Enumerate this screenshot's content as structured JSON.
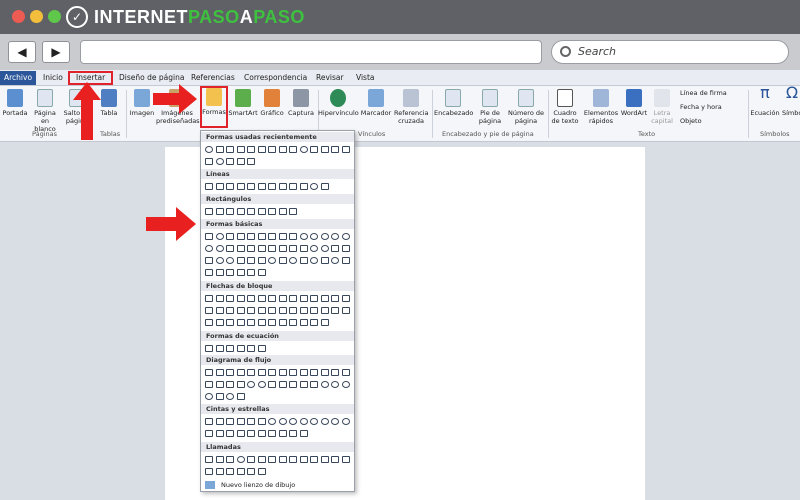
{
  "site_logo": {
    "mark": "✓",
    "text_a": "INTERNET",
    "text_b": "PASO",
    "text_c": "A",
    "text_d": "PASO"
  },
  "browser": {
    "back_label": "◀",
    "forward_label": "▶",
    "search_placeholder": "Search"
  },
  "menu_tabs": [
    "Archivo",
    "Inicio",
    "Insertar",
    "Diseño de página",
    "Referencias",
    "Correspondencia",
    "Revisar",
    "Vista"
  ],
  "ribbon": {
    "buttons": [
      "Portada",
      "Página en blanco",
      "Salto de página",
      "Tabla",
      "Imagen",
      "Imágenes prediseñadas",
      "Formas",
      "SmartArt",
      "Gráfico",
      "Captura",
      "Hipervínculo",
      "Marcador",
      "Referencia cruzada",
      "Encabezado",
      "Pie de página",
      "Número de página",
      "Cuadro de texto",
      "Elementos rápidos",
      "WordArt",
      "Letra capital",
      "Línea de firma",
      "Fecha y hora",
      "Objeto",
      "Ecuación",
      "Símbolo"
    ],
    "groups": [
      "Páginas",
      "Tablas",
      "Vínculos",
      "Encabezado y pie de página",
      "Texto",
      "Símbolos"
    ]
  },
  "shapes_menu": {
    "sections": [
      "Formas usadas recientemente",
      "Líneas",
      "Rectángulos",
      "Formas básicas",
      "Flechas de bloque",
      "Formas de ecuación",
      "Diagrama de flujo",
      "Cintas y estrellas",
      "Llamadas"
    ],
    "new_canvas": "Nuevo lienzo de dibujo"
  },
  "colors": {
    "accent": "#2b579a",
    "highlight": "#e0232a",
    "arrow": "#e8201f",
    "logo_green": "#3ec13e"
  }
}
